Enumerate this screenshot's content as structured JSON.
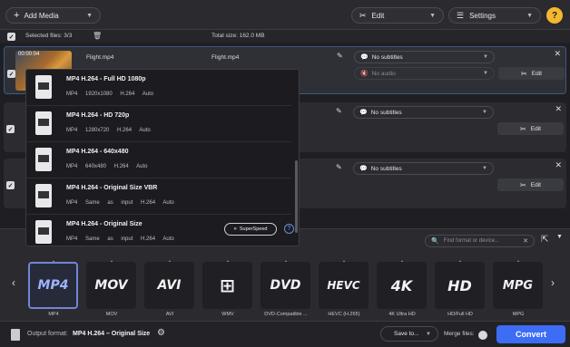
{
  "toolbar": {
    "add_media": "Add Media",
    "edit": "Edit",
    "settings": "Settings",
    "help": "?"
  },
  "selection": {
    "selected_files": "Selected files: 3/3",
    "total_size": "Total size: 162.0 MB"
  },
  "files": [
    {
      "duration": "00:00:04",
      "name": "Flight.mp4",
      "output_name": "Flight.mp4",
      "subtitles": "No subtitles",
      "audio": "No audio",
      "edit": "Edit"
    },
    {
      "subtitles": "No subtitles",
      "edit": "Edit"
    },
    {
      "subtitles": "No subtitles",
      "edit": "Edit"
    }
  ],
  "preset_dropdown": {
    "options": [
      {
        "title": "MP4 H.264 - Full HD 1080p",
        "container": "MP4",
        "size": "1920x1080",
        "codec": "H.264",
        "audio": "Auto"
      },
      {
        "title": "MP4 H.264 - HD 720p",
        "container": "MP4",
        "size": "1280x720",
        "codec": "H.264",
        "audio": "Auto"
      },
      {
        "title": "MP4 H.264 - 640x480",
        "container": "MP4",
        "size": "640x480",
        "codec": "H.264",
        "audio": "Auto"
      },
      {
        "title": "MP4 H.264 - Original Size VBR",
        "container": "MP4",
        "size": "Same as input",
        "codec": "H.264",
        "audio": "Auto"
      },
      {
        "title": "MP4 H.264 - Original Size",
        "container": "MP4",
        "size": "Same as input",
        "codec": "H.264",
        "audio": "Auto"
      }
    ],
    "superspeed": "SuperSpeed",
    "info": "?"
  },
  "format_panel": {
    "search_placeholder": "Find format or device...",
    "formats": [
      {
        "tile": "MP4",
        "label": "MP4"
      },
      {
        "tile": "MOV",
        "label": "MOV"
      },
      {
        "tile": "AVI",
        "label": "AVI"
      },
      {
        "tile": "⊞",
        "label": "WMV"
      },
      {
        "tile": "DVD",
        "label": "DVD-Compatible ..."
      },
      {
        "tile": "HEVC",
        "label": "HEVC (H.265)"
      },
      {
        "tile": "4K",
        "label": "4K Ultra HD"
      },
      {
        "tile": "HD",
        "label": "HD/Full HD"
      },
      {
        "tile": "MPG",
        "label": "MPG"
      }
    ],
    "active_index": 0
  },
  "bottom": {
    "output_format_label": "Output format:",
    "output_format_value": "MP4 H.264 – Original Size",
    "save_to": "Save to...",
    "merge_files": "Merge files:",
    "convert": "Convert"
  },
  "colors": {
    "accent": "#3d6cf5",
    "help": "#f3b82e",
    "active_format": "#6f86d6"
  }
}
